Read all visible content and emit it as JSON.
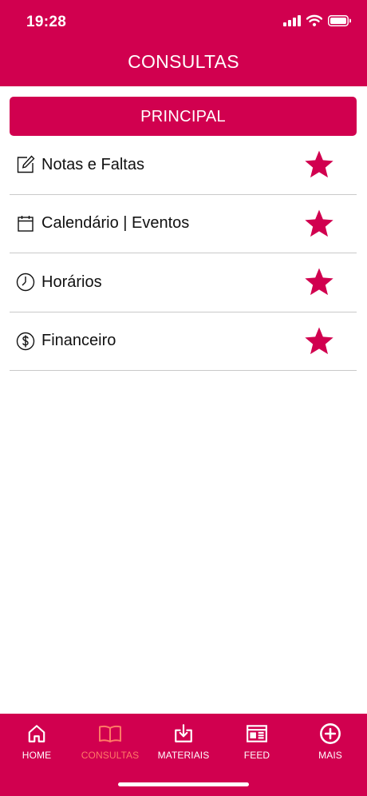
{
  "status_bar": {
    "time": "19:28"
  },
  "header": {
    "title": "CONSULTAS"
  },
  "section": {
    "title": "PRINCIPAL"
  },
  "menu": {
    "items": [
      {
        "label": "Notas e Faltas",
        "icon": "edit-note-icon",
        "favorite": true
      },
      {
        "label": "Calendário | Eventos",
        "icon": "calendar-icon",
        "favorite": true
      },
      {
        "label": "Horários",
        "icon": "clock-icon",
        "favorite": true
      },
      {
        "label": "Financeiro",
        "icon": "dollar-coin-icon",
        "favorite": true
      }
    ]
  },
  "tabbar": {
    "items": [
      {
        "label": "HOME",
        "icon": "home-icon",
        "active": false
      },
      {
        "label": "CONSULTAS",
        "icon": "open-book-icon",
        "active": true
      },
      {
        "label": "MATERIAIS",
        "icon": "download-icon",
        "active": false
      },
      {
        "label": "FEED",
        "icon": "newspaper-icon",
        "active": false
      },
      {
        "label": "MAIS",
        "icon": "plus-circle-icon",
        "active": false
      }
    ]
  },
  "colors": {
    "brand": "#d1004f",
    "active_tab": "#ff7a66",
    "divider": "#c9c9c9"
  }
}
